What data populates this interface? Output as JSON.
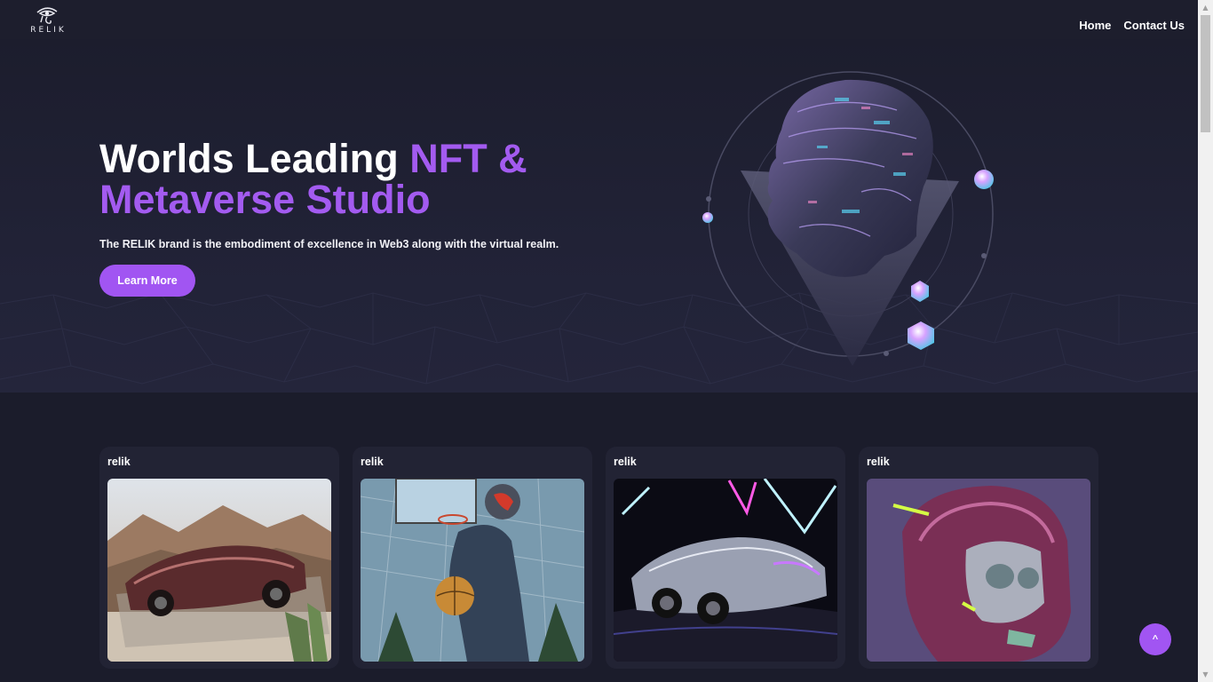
{
  "brand": {
    "name": "RELIK",
    "logo_icon": "eye-of-ra-icon"
  },
  "nav": {
    "items": [
      {
        "label": "Home"
      },
      {
        "label": "Contact Us"
      }
    ]
  },
  "hero": {
    "title_white": "Worlds Leading ",
    "title_accent_1": "NFT &",
    "title_accent_2": "Metaverse Studio",
    "subtitle": "The RELIK brand is the embodiment of excellence in Web3 along with the virtual realm.",
    "cta_label": "Learn More"
  },
  "cards": [
    {
      "label": "relik",
      "image": "red-sports-car-desert"
    },
    {
      "label": "relik",
      "image": "astronaut-basketball"
    },
    {
      "label": "relik",
      "image": "silver-sports-car-neon"
    },
    {
      "label": "relik",
      "image": "pink-helmet-skull"
    }
  ],
  "back_to_top": {
    "label": "^"
  },
  "colors": {
    "accent": "#a155f2",
    "background": "#1b1c2b",
    "card": "#222334"
  }
}
